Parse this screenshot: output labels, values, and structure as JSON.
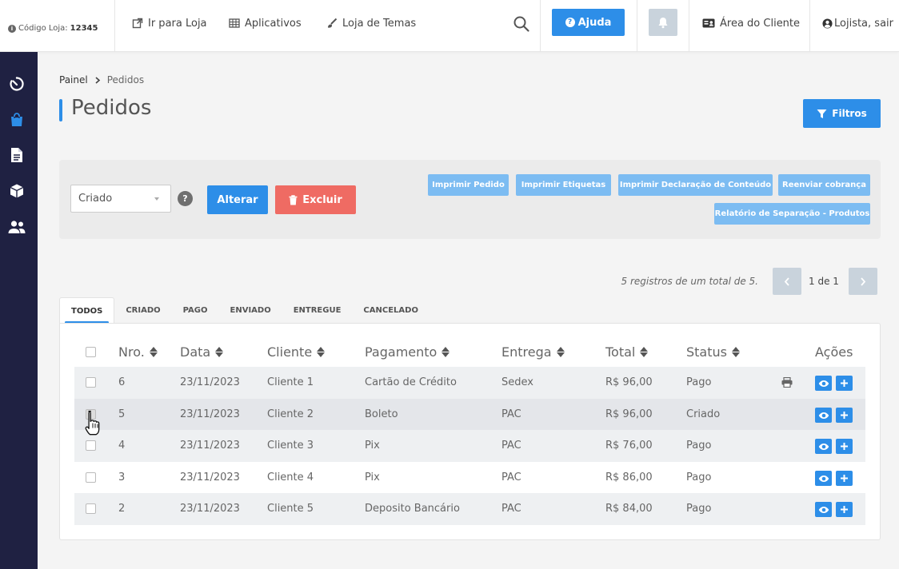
{
  "topbar": {
    "store_code_label": "Código Loja:",
    "store_code_value": "12345",
    "links": [
      {
        "label": "Ir para Loja",
        "icon": "external-link-icon"
      },
      {
        "label": "Aplicativos",
        "icon": "grid-icon"
      },
      {
        "label": "Loja de Temas",
        "icon": "brush-icon"
      }
    ],
    "help_label": "Ajuda",
    "client_area_label": "Área do Cliente",
    "user_label": "Lojista, sair"
  },
  "sidebar": {
    "items": [
      {
        "icon": "timer-icon"
      },
      {
        "icon": "shopping-bag-icon",
        "active": true
      },
      {
        "icon": "document-icon"
      },
      {
        "icon": "box-icon"
      },
      {
        "icon": "users-icon"
      }
    ]
  },
  "breadcrumb": {
    "root": "Painel",
    "current": "Pedidos"
  },
  "page": {
    "title": "Pedidos",
    "filter_label": "Filtros"
  },
  "actions": {
    "status_value": "Criado",
    "help_symbol": "?",
    "alterar_label": "Alterar",
    "excluir_label": "Excluir",
    "print_buttons": [
      "Imprimir Pedido",
      "Imprimir Etiquetas",
      "Imprimir Declaração de Conteúdo",
      "Reenviar cobrança",
      "Relatório de Separação - Produtos"
    ]
  },
  "pagination": {
    "records_text": "5 registros de um total de 5.",
    "page_label": "1 de 1"
  },
  "tabs": [
    "TODOS",
    "CRIADO",
    "PAGO",
    "ENVIADO",
    "ENTREGUE",
    "CANCELADO"
  ],
  "table": {
    "headers": [
      "Nro.",
      "Data",
      "Cliente",
      "Pagamento",
      "Entrega",
      "Total",
      "Status",
      "Ações"
    ],
    "rows": [
      {
        "nro": "6",
        "data": "23/11/2023",
        "cliente": "Cliente 1",
        "pagamento": "Cartão de Crédito",
        "entrega": "Sedex",
        "total": "R$ 96,00",
        "status": "Pago"
      },
      {
        "nro": "5",
        "data": "23/11/2023",
        "cliente": "Cliente 2",
        "pagamento": "Boleto",
        "entrega": "PAC",
        "total": "R$ 96,00",
        "status": "Criado"
      },
      {
        "nro": "4",
        "data": "23/11/2023",
        "cliente": "Cliente 3",
        "pagamento": "Pix",
        "entrega": "PAC",
        "total": "R$ 76,00",
        "status": "Pago"
      },
      {
        "nro": "3",
        "data": "23/11/2023",
        "cliente": "Cliente 4",
        "pagamento": "Pix",
        "entrega": "PAC",
        "total": "R$ 86,00",
        "status": "Pago"
      },
      {
        "nro": "2",
        "data": "23/11/2023",
        "cliente": "Cliente 5",
        "pagamento": "Deposito Bancário",
        "entrega": "PAC",
        "total": "R$ 84,00",
        "status": "Pago"
      }
    ]
  },
  "colors": {
    "primary": "#2d8ee8",
    "danger": "#ef6b63",
    "sidebar": "#1f2142",
    "light_button": "#7cbcf2"
  }
}
